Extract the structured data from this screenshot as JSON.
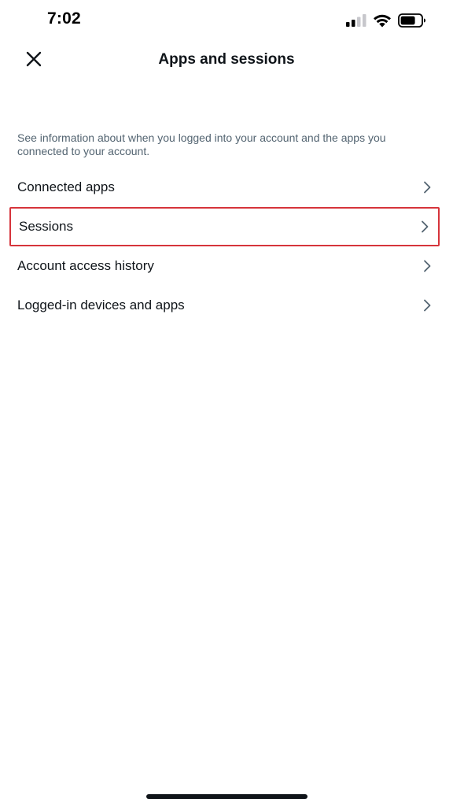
{
  "status_bar": {
    "time": "7:02",
    "signal_icon": "cellular-signal-icon",
    "wifi_icon": "wifi-icon",
    "battery_icon": "battery-icon"
  },
  "header": {
    "title": "Apps and sessions",
    "close_icon": "close-icon"
  },
  "description": "See information about when you logged into your account and the apps you connected to your account.",
  "menu": {
    "items": [
      {
        "label": "Connected apps",
        "icon": "chevron-right-icon"
      },
      {
        "label": "Sessions",
        "icon": "chevron-right-icon",
        "highlighted": true
      },
      {
        "label": "Account access history",
        "icon": "chevron-right-icon"
      },
      {
        "label": "Logged-in devices and apps",
        "icon": "chevron-right-icon"
      }
    ]
  },
  "colors": {
    "text_primary": "#0f1419",
    "text_secondary": "#536471",
    "highlight_border": "#d6343b",
    "background": "#ffffff"
  }
}
